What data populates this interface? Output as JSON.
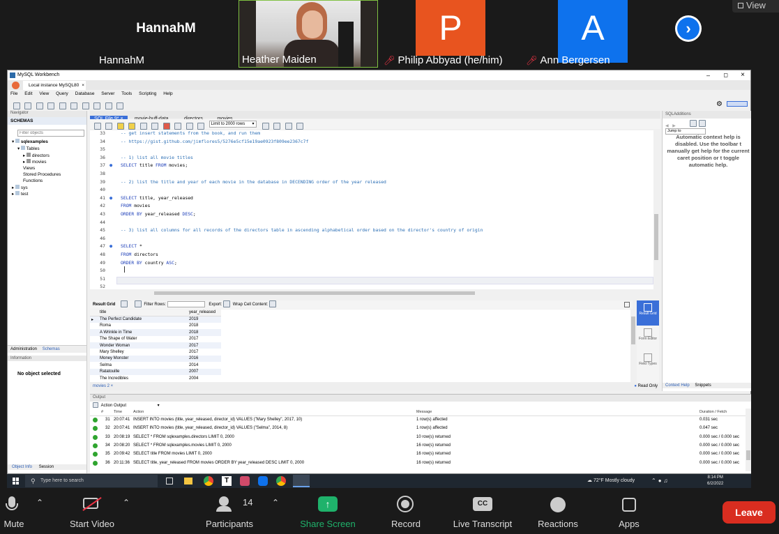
{
  "meeting": {
    "view_label": "View",
    "participants": [
      {
        "name": "HannahM",
        "tile_label": "HannahM",
        "muted": false,
        "tile_color": "#1a1a1a"
      },
      {
        "name": "Heather Maiden",
        "muted": false,
        "active_speaker": true
      },
      {
        "name": "Philip Abbyad (he/him)",
        "initial": "P",
        "muted": true,
        "tile_color": "#e8541f"
      },
      {
        "name": "Ann Bergersen",
        "initial": "A",
        "muted": true,
        "tile_color": "#0e72ed"
      }
    ]
  },
  "workbench": {
    "window_title": "MySQL Workbench",
    "connection_tab": "Local instance MySQL80",
    "menu": [
      "File",
      "Edit",
      "View",
      "Query",
      "Database",
      "Server",
      "Tools",
      "Scripting",
      "Help"
    ],
    "navigator": {
      "title": "Navigator",
      "schemas_label": "SCHEMAS",
      "filter_placeholder": "Filter objects",
      "tree": {
        "db": "sqlexamples",
        "tables": "Tables",
        "table_items": [
          "directors",
          "movies"
        ],
        "other": [
          "Views",
          "Stored Procedures",
          "Functions"
        ],
        "dbs": [
          "sys",
          "test"
        ]
      },
      "tabs": [
        "Administration",
        "Schemas"
      ],
      "info_title": "Information",
      "no_object": "No object selected",
      "bottom_tabs": [
        "Object Info",
        "Session"
      ]
    },
    "editor_tabs": [
      "SQL File 9*",
      "movie-buff-data",
      "directors",
      "movies"
    ],
    "limit_label": "Limit to 2000 rows",
    "code_lines": [
      {
        "n": "33",
        "text": "-- get insert statements from the book, and run them",
        "kind": "comment"
      },
      {
        "n": "34",
        "text": "-- https://gist.github.com/jimflores5/5276e5cf15e19ae0923f809ee2367c7f",
        "kind": "comment"
      },
      {
        "n": "35",
        "text": "",
        "kind": "plain"
      },
      {
        "n": "36",
        "text": "-- 1) list all movie titles",
        "kind": "comment"
      },
      {
        "n": "37",
        "text": "SELECT title FROM movies;",
        "kind": "sql",
        "dot": true
      },
      {
        "n": "38",
        "text": "",
        "kind": "plain"
      },
      {
        "n": "39",
        "text": "-- 2) list the title and year of each movie in the database in DECENDING order of the year released",
        "kind": "comment"
      },
      {
        "n": "40",
        "text": "",
        "kind": "plain"
      },
      {
        "n": "41",
        "text": "SELECT title, year_released",
        "kind": "sql",
        "dot": true
      },
      {
        "n": "42",
        "text": "FROM movies",
        "kind": "sql"
      },
      {
        "n": "43",
        "text": "ORDER BY year_released DESC;",
        "kind": "sql"
      },
      {
        "n": "44",
        "text": "",
        "kind": "plain"
      },
      {
        "n": "45",
        "text": "-- 3) list all columns for all records of the directors table in ascending alphabetical order based on the director's country of origin",
        "kind": "comment"
      },
      {
        "n": "46",
        "text": "",
        "kind": "plain"
      },
      {
        "n": "47",
        "text": "SELECT *",
        "kind": "sql",
        "dot": true
      },
      {
        "n": "48",
        "text": "FROM directors",
        "kind": "sql"
      },
      {
        "n": "49",
        "text": "ORDER BY country ASC;",
        "kind": "sql"
      },
      {
        "n": "50",
        "text": "",
        "kind": "plain"
      },
      {
        "n": "51",
        "text": "",
        "kind": "plain"
      },
      {
        "n": "52",
        "text": "",
        "kind": "plain"
      }
    ],
    "result_bar": {
      "result_grid": "Result Grid",
      "filter_rows": "Filter Rows:",
      "export": "Export:",
      "wrap": "Wrap Cell Content:"
    },
    "result_columns": [
      "title",
      "year_released"
    ],
    "result_rows": [
      [
        "The Perfect Candidate",
        "2019"
      ],
      [
        "Roma",
        "2018"
      ],
      [
        "A Wrinkle in Time",
        "2018"
      ],
      [
        "The Shape of Water",
        "2017"
      ],
      [
        "Wonder Woman",
        "2017"
      ],
      [
        "Mary Shelley",
        "2017"
      ],
      [
        "Money Monster",
        "2016"
      ],
      [
        "Selma",
        "2014"
      ],
      [
        "Ratatouille",
        "2007"
      ],
      [
        "The Incredibles",
        "2004"
      ]
    ],
    "result_tab": "movies 2",
    "side_panel": [
      "Result Grid",
      "Form Editor",
      "Field Types"
    ],
    "read_only": "Read Only",
    "sql_additions": {
      "title": "SQLAdditions",
      "jump_to": "Jump to",
      "help_text": "Automatic context help is disabled. Use the toolbar t manually get help for the current caret position or t toggle automatic help.",
      "tabs": [
        "Context Help",
        "Snippets"
      ]
    },
    "output": {
      "title": "Output",
      "mode": "Action Output",
      "columns": [
        "#",
        "Time",
        "Action",
        "Message",
        "Duration / Fetch"
      ],
      "rows": [
        {
          "n": "31",
          "time": "20:07:41",
          "action": "INSERT INTO movies (title, year_released, director_id) VALUES (\"Mary Shelley\", 2017, 10)",
          "msg": "1 row(s) affected",
          "dur": "0.031 sec"
        },
        {
          "n": "32",
          "time": "20:07:41",
          "action": "INSERT INTO movies (title, year_released, director_id) VALUES (\"Selma\", 2014, 8)",
          "msg": "1 row(s) affected",
          "dur": "0.047 sec"
        },
        {
          "n": "33",
          "time": "20:08:19",
          "action": "SELECT * FROM sqlexamples.directors LIMIT 0, 2000",
          "msg": "10 row(s) returned",
          "dur": "0.000 sec / 0.000 sec"
        },
        {
          "n": "34",
          "time": "20:08:20",
          "action": "SELECT * FROM sqlexamples.movies LIMIT 0, 2000",
          "msg": "16 row(s) returned",
          "dur": "0.000 sec / 0.000 sec"
        },
        {
          "n": "35",
          "time": "20:09:42",
          "action": "SELECT title FROM movies LIMIT 0, 2000",
          "msg": "16 row(s) returned",
          "dur": "0.000 sec / 0.000 sec"
        },
        {
          "n": "36",
          "time": "20:11:36",
          "action": "SELECT title, year_released FROM movies ORDER BY year_released DESC LIMIT 0, 2000",
          "msg": "16 row(s) returned",
          "dur": "0.000 sec / 0.000 sec"
        }
      ]
    }
  },
  "taskbar": {
    "search_placeholder": "Type here to search",
    "weather": "72°F Mostly cloudy",
    "time": "8:14 PM",
    "date": "6/2/2022"
  },
  "zoom_toolbar": {
    "mute": "Mute",
    "start_video": "Start Video",
    "participants": "Participants",
    "participants_count": "14",
    "share": "Share Screen",
    "record": "Record",
    "transcript": "Live Transcript",
    "reactions": "Reactions",
    "apps": "Apps",
    "leave": "Leave"
  },
  "colors": {
    "accent": "#0e72ed",
    "leave": "#d92d20",
    "share": "#1fb26b"
  }
}
